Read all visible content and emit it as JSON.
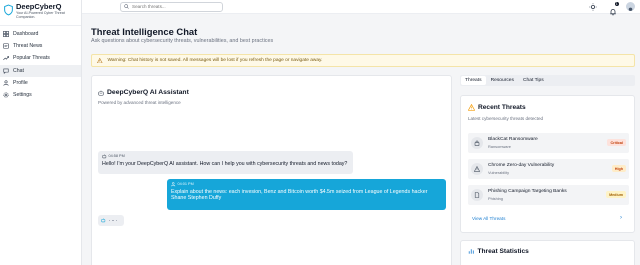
{
  "brand": {
    "name": "DeepCyberQ",
    "tagline_line1": "Your AI-Powered Cyber Threat",
    "tagline_line2": "Companion."
  },
  "nav": [
    {
      "label": "Dashboard",
      "icon": "dashboard-icon"
    },
    {
      "label": "Threat News",
      "icon": "news-icon"
    },
    {
      "label": "Popular Threats",
      "icon": "trending-icon"
    },
    {
      "label": "Chat",
      "icon": "chat-icon"
    },
    {
      "label": "Profile",
      "icon": "user-icon"
    },
    {
      "label": "Settings",
      "icon": "gear-icon"
    }
  ],
  "active_nav": "Chat",
  "topbar": {
    "search_placeholder": "Search threats...",
    "notification_count": "1"
  },
  "page": {
    "title": "Threat Intelligence Chat",
    "subtitle": "Ask questions about cybersecurity threats, vulnerabilities, and best practices"
  },
  "warning": {
    "text": "Warning: Chat history is not saved. All messages will be lost if you refresh the page or navigate away."
  },
  "chat": {
    "title": "DeepCyberQ AI Assistant",
    "subtitle": "Powered by advanced threat intelligence",
    "messages": [
      {
        "role": "assistant",
        "time": "04:58 PM",
        "text": "Hello! I'm your DeepCyberQ AI assistant. How can I help you with cybersecurity threats and news today?"
      },
      {
        "role": "user",
        "time": "04:01 PM",
        "text_line1": "Explain about the news: each invesion, Benz and Bitcoin worth $4.5m seized from League of Legends hacker",
        "text_line2": "Shane Stephen Duffy"
      }
    ]
  },
  "tabs": [
    "Threats",
    "Resources",
    "Chat Tips"
  ],
  "active_tab": "Threats",
  "recent_threats": {
    "title": "Recent Threats",
    "subtitle": "Latest cybersecurity threats detected",
    "items": [
      {
        "name": "BlackCat Ransomware",
        "category": "Ransomware",
        "severity": "Critical",
        "sev_bg": "#fde2dc",
        "sev_fg": "#c2410c"
      },
      {
        "name": "Chrome Zero-day Vulnerability",
        "category": "Vulnerability",
        "severity": "High",
        "sev_bg": "#feecc8",
        "sev_fg": "#c2410c"
      },
      {
        "name": "Phishing Campaign Targeting Banks",
        "category": "Phishing",
        "severity": "Medium",
        "sev_bg": "#fef3c7",
        "sev_fg": "#a16207"
      }
    ],
    "view_all": "View All Threats"
  },
  "stats": {
    "title": "Threat Statistics"
  },
  "colors": {
    "accent": "#16a6d9",
    "warning_bg": "#fef9e7",
    "link": "#1d7fd1"
  }
}
